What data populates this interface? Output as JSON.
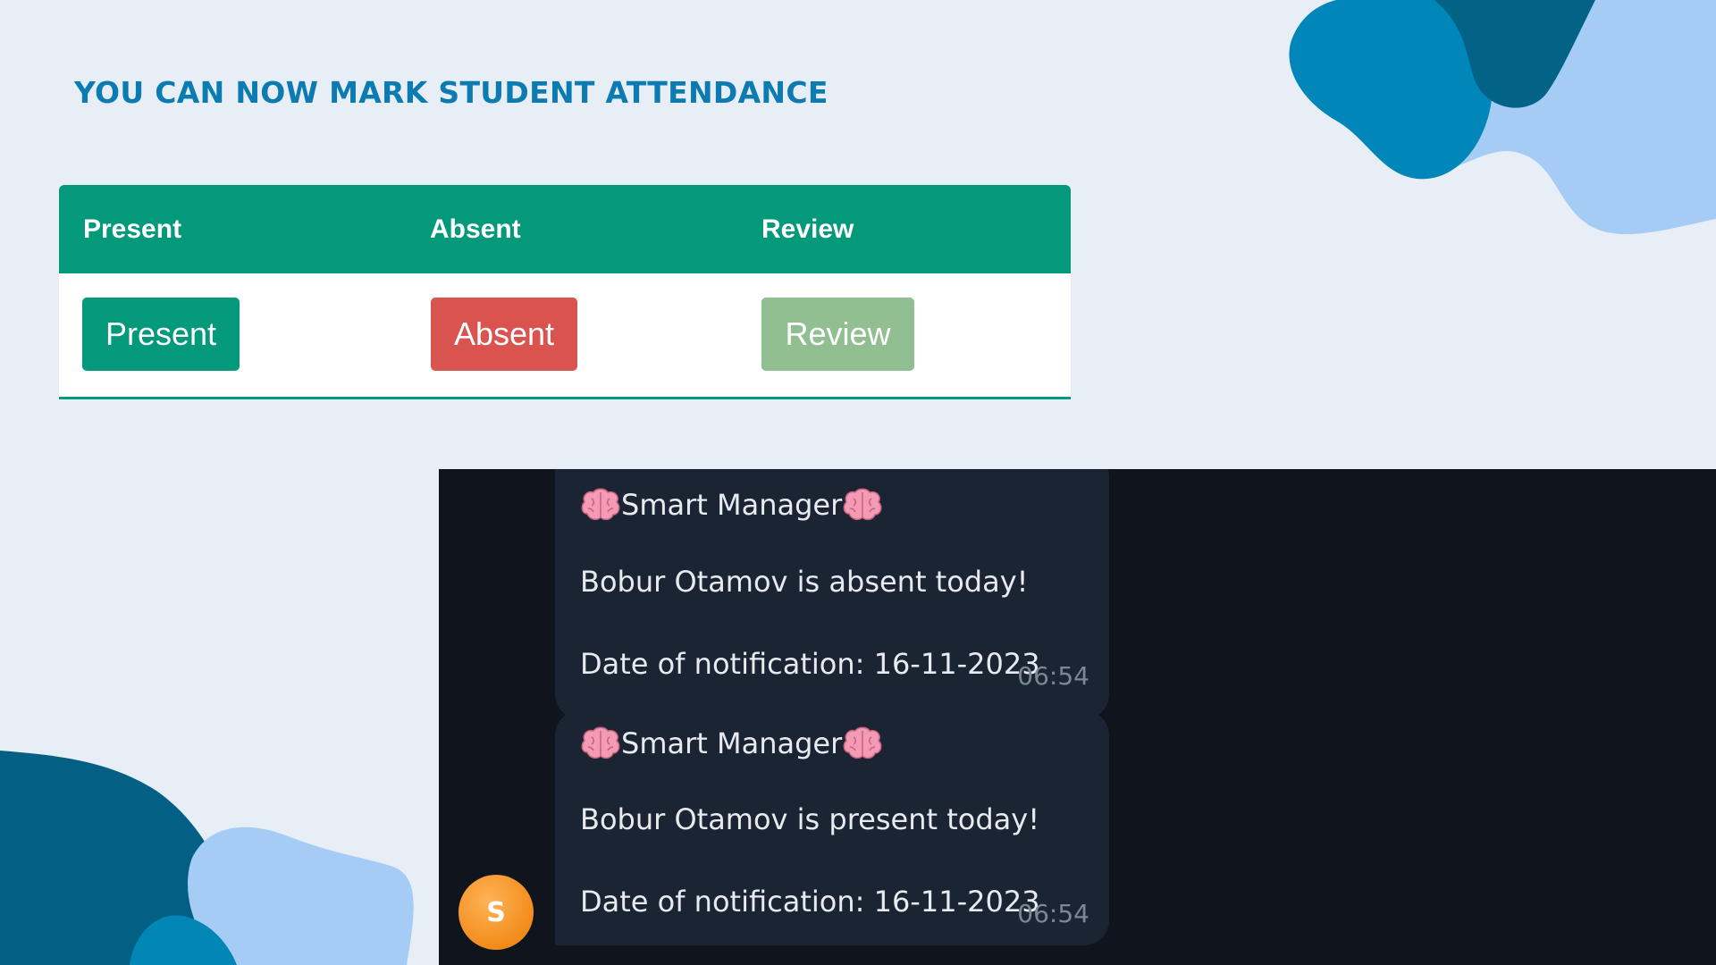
{
  "headline": "YOU CAN NOW MARK STUDENT ATTENDANCE",
  "attendance_table": {
    "columns": [
      "Present",
      "Absent",
      "Review"
    ],
    "buttons": {
      "present": "Present",
      "absent": "Absent",
      "review": "Review"
    }
  },
  "chat": {
    "messages": [
      {
        "sender": "Smart Manager",
        "text": "Bobur Otamov is absent today!",
        "date_line": "Date of notification: 16-11-2023",
        "time": "06:54"
      },
      {
        "sender": "Smart Manager",
        "text": "Bobur Otamov is present today!",
        "date_line": "Date of notification: 16-11-2023",
        "time": "06:54"
      }
    ],
    "avatar_initial": "S",
    "title_icon": "brain-emoji"
  },
  "colors": {
    "background": "#e8eef6",
    "headline": "#0b7bb2",
    "table_header": "#03997a",
    "present": "#03997a",
    "absent": "#d9534f",
    "review": "#92bf92",
    "chat_background": "#0f141d",
    "bubble": "#1a2432",
    "avatar": "#f28c1b"
  }
}
